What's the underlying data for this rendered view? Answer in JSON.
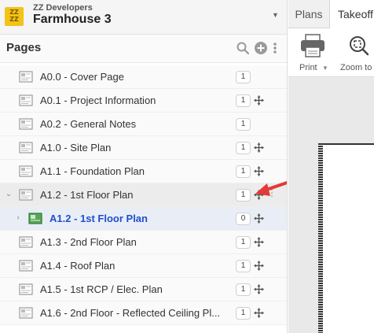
{
  "header": {
    "logo_text_1": "ZZ",
    "logo_text_2": "ZZ",
    "company": "ZZ Developers",
    "project": "Farmhouse 3"
  },
  "pages_panel": {
    "title": "Pages",
    "icons": [
      "search-icon",
      "add-icon",
      "more-vertical-icon"
    ]
  },
  "pages": [
    {
      "label": "A0.0 - Cover Page",
      "count": "1",
      "pan": false
    },
    {
      "label": "A0.1 - Project Information",
      "count": "1",
      "pan": true
    },
    {
      "label": "A0.2 - General Notes",
      "count": "1",
      "pan": false
    },
    {
      "label": "A1.0 - Site Plan",
      "count": "1",
      "pan": true
    },
    {
      "label": "A1.1 - Foundation Plan",
      "count": "1",
      "pan": true
    },
    {
      "label": "A1.2 - 1st Floor Plan",
      "count": "1",
      "pan": true,
      "expanded": true,
      "selected": true
    },
    {
      "label": "A1.2 - 1st Floor Plan",
      "count": "0",
      "pan": true,
      "child": true
    },
    {
      "label": "A1.3 - 2nd Floor Plan",
      "count": "1",
      "pan": true
    },
    {
      "label": "A1.4 - Roof Plan",
      "count": "1",
      "pan": true
    },
    {
      "label": "A1.5 - 1st RCP / Elec. Plan",
      "count": "1",
      "pan": true
    },
    {
      "label": "A1.6 - 2nd Floor - Reflected Ceiling Pl...",
      "count": "1",
      "pan": true
    }
  ],
  "right_panel": {
    "tabs": [
      "Plans",
      "Takeoff"
    ],
    "tools": {
      "print": "Print",
      "zoom": "Zoom to"
    }
  },
  "colors": {
    "accent_blue": "#1f4fcc",
    "logo_yellow": "#f2c318",
    "annotation_red": "#e23a34"
  }
}
